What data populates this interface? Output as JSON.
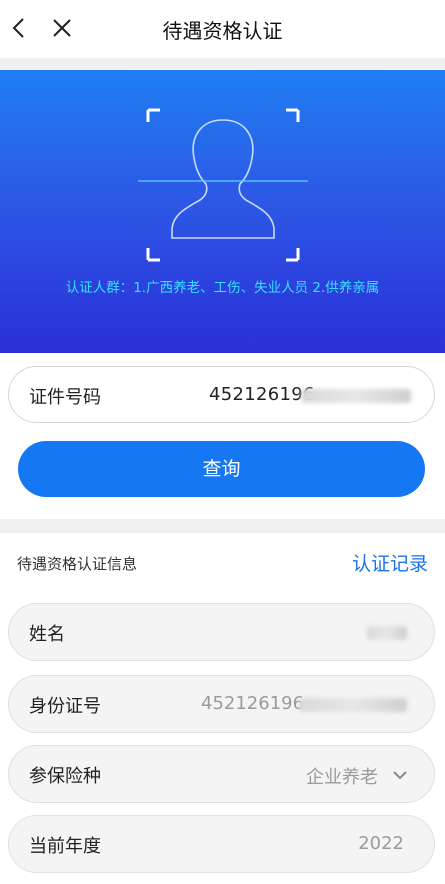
{
  "header": {
    "title": "待遇资格认证",
    "back_icon": "chevron-left-icon",
    "close_icon": "close-icon"
  },
  "banner": {
    "crowd_text": "认证人群：1.广西养老、工伤、失业人员   2.供养亲属"
  },
  "id_query": {
    "label": "证件号码",
    "value": "452126196"
  },
  "query_button": {
    "label": "查询"
  },
  "section": {
    "title": "待遇资格认证信息",
    "record_link": "认证记录"
  },
  "fields": [
    {
      "label": "姓名",
      "value": ""
    },
    {
      "label": "身份证号",
      "value": "452126196"
    },
    {
      "label": "参保险种",
      "value": "企业养老"
    },
    {
      "label": "当前年度",
      "value": "2022"
    }
  ],
  "colors": {
    "primary": "#1677f2",
    "banner_top": "#1f7ef2",
    "banner_bottom": "#2a2fd7",
    "crowd_text": "#37e0ff"
  }
}
